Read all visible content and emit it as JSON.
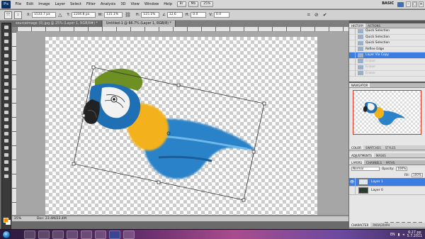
{
  "app": {
    "logo": "Ps"
  },
  "menu": [
    "File",
    "Edit",
    "Image",
    "Layer",
    "Select",
    "Filter",
    "Analysis",
    "3D",
    "View",
    "Window",
    "Help"
  ],
  "top_buttons": [
    "Br",
    "Mb",
    "25%"
  ],
  "workspace_label": "BASIC",
  "cs_live": "CS Live",
  "window_controls": {
    "minimize": "–",
    "maximize": "□",
    "close": "×"
  },
  "options": {
    "x": {
      "label": "X:",
      "value": "1533.7 px"
    },
    "y": {
      "label": "Y:",
      "value": "1104.8 px"
    },
    "w": {
      "label": "W:",
      "value": "115.1%"
    },
    "h": {
      "label": "H:",
      "value": "115.1%"
    },
    "angle": {
      "label": "∠",
      "value": "12.6"
    },
    "skew_h": {
      "label": "H:",
      "value": "0.0"
    },
    "skew_v": {
      "label": "V:",
      "value": "0.0"
    },
    "cancel": "⊘",
    "commit": "✔"
  },
  "doc_tabs": [
    {
      "label": "sourceimage (0).jpg @ 25% (Layer 1, RGB/8#) *",
      "active": false
    },
    {
      "label": "Untitled-1 @ 66.7% (Layer 1, RGB/8) *",
      "active": true
    }
  ],
  "status": {
    "zoom": "25%",
    "doc": "Doc: 23.4M/23.4M"
  },
  "colors": {
    "foreground": "#f28c00",
    "background": "#ffffff",
    "selection": "#3b7de3"
  },
  "history": {
    "tabs": [
      "HISTORY",
      "ACTIONS"
    ],
    "items": [
      {
        "label": "Quick Selection",
        "state": "normal"
      },
      {
        "label": "Quick Selection",
        "state": "normal"
      },
      {
        "label": "Quick Selection",
        "state": "normal"
      },
      {
        "label": "Refine Edge",
        "state": "normal"
      },
      {
        "label": "Layer Via Copy",
        "state": "selected"
      },
      {
        "label": "Eraser",
        "state": "dim"
      },
      {
        "label": "Eraser",
        "state": "dim"
      },
      {
        "label": "Eraser",
        "state": "dim"
      },
      {
        "label": "Eraser",
        "state": "dim"
      }
    ]
  },
  "navigator": {
    "title": "NAVIGATOR"
  },
  "color_tabs": [
    "COLOR",
    "SWATCHES",
    "STYLES"
  ],
  "adj_tabs": [
    "ADJUSTMENTS",
    "MASKS"
  ],
  "layers": {
    "tabs": [
      "LAYERS",
      "CHANNELS",
      "PATHS"
    ],
    "blend_mode": "Normal",
    "opacity_label": "Opacity:",
    "opacity": "100%",
    "fill_label": "Fill:",
    "fill": "100%",
    "items": [
      {
        "name": "Layer 1",
        "selected": true,
        "visible": true
      },
      {
        "name": "Layer 0",
        "selected": false,
        "visible": false
      }
    ]
  },
  "char_tabs": [
    "CHARACTER",
    "PARAGRAPH"
  ],
  "tray": {
    "lang": "EN",
    "time": "6:27 pp",
    "date": "5.7.2011"
  }
}
